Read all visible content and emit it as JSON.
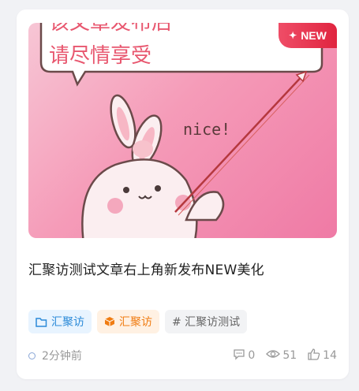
{
  "card": {
    "badge": "NEW",
    "image_text_line1": "该文章发布后",
    "image_text_line2": "请尽情享受",
    "image_caption": "nice!",
    "title": "汇聚访测试文章右上角新发布NEW美化",
    "tags": [
      {
        "label": "汇聚访",
        "icon": "folder-icon",
        "color": "#2b8ad8"
      },
      {
        "label": "汇聚访",
        "icon": "box-icon",
        "color": "#f07c12"
      },
      {
        "label": "# 汇聚访测试",
        "icon": "hash-icon",
        "color": "#666666"
      }
    ],
    "time": "2分钟前",
    "comments": "0",
    "views": "51",
    "likes": "14"
  },
  "colors": {
    "badge": "#e0243f",
    "background": "#f1f2f5"
  }
}
